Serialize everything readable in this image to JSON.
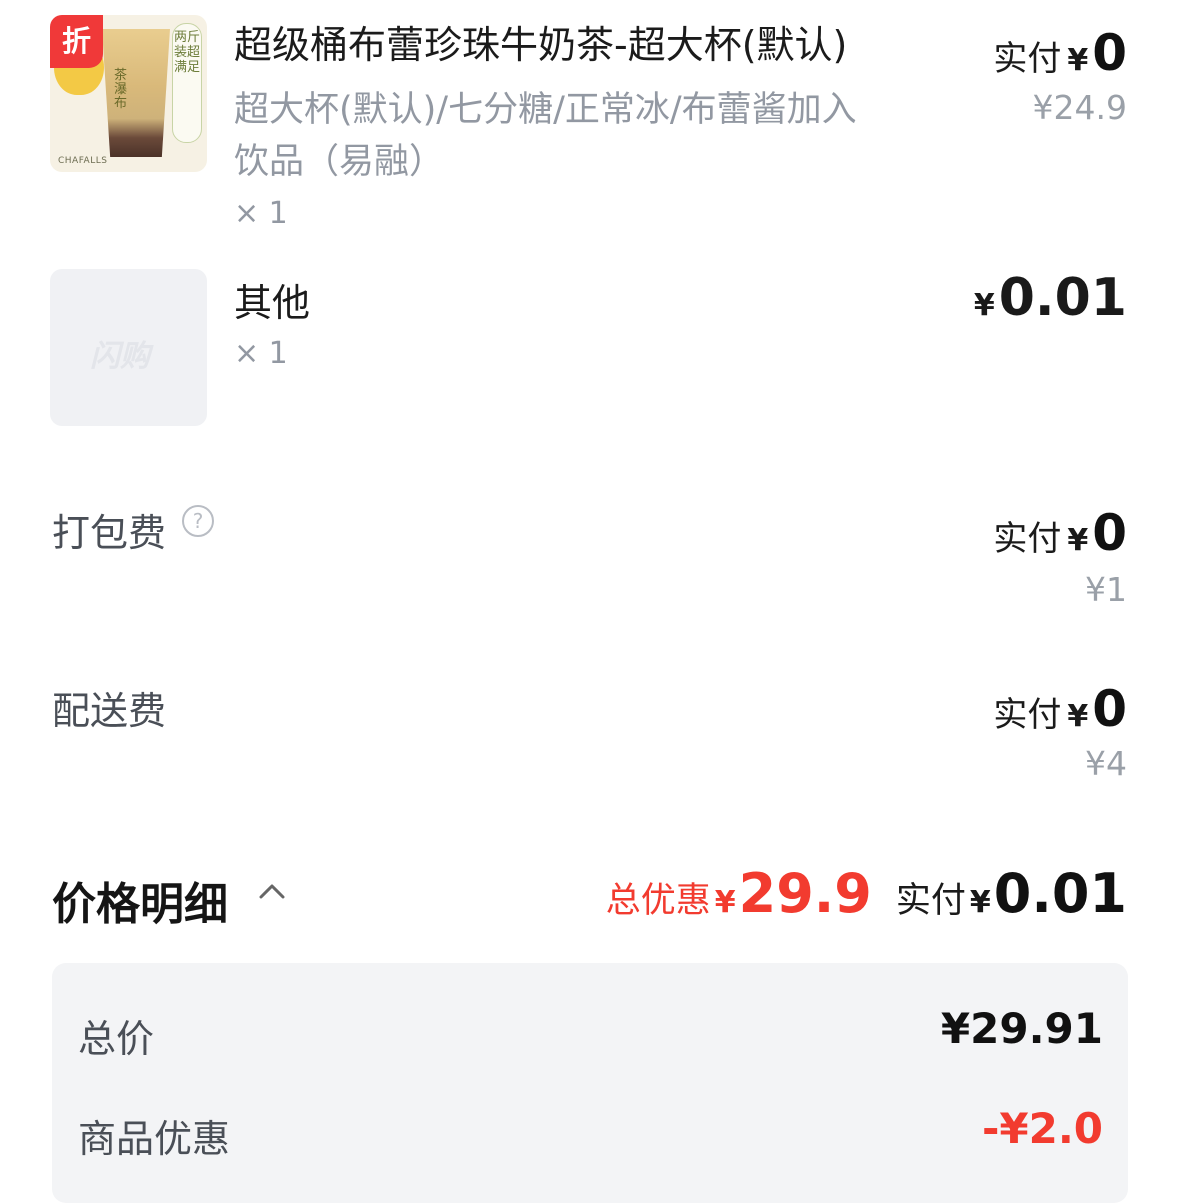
{
  "items": [
    {
      "badge": "折",
      "thumb_label": "两斤装超满足",
      "thumb_cup_text": "茶瀑布",
      "thumb_brand": "CHAFALLS",
      "name": "超级桶布蕾珍珠牛奶茶-超大杯(默认)",
      "spec": "超大杯(默认)/七分糖/正常冰/布蕾酱加入饮品（易融）",
      "qty": "× 1",
      "pay_label": "实付",
      "pay_currency": "¥",
      "pay_value": "0",
      "original_price": "¥24.9"
    },
    {
      "thumb_watermark": "闪购",
      "name": "其他",
      "qty": "× 1",
      "price_currency": "¥",
      "price_value": "0.01"
    }
  ],
  "fees": [
    {
      "label": "打包费",
      "help_icon": "question-circle-icon",
      "pay_label": "实付",
      "pay_currency": "¥",
      "pay_value": "0",
      "original_price": "¥1"
    },
    {
      "label": "配送费",
      "pay_label": "实付",
      "pay_currency": "¥",
      "pay_value": "0",
      "original_price": "¥4"
    }
  ],
  "price_detail": {
    "title": "价格明细",
    "toggle_icon": "chevron-up-icon",
    "discount_label": "总优惠",
    "discount_currency": "¥",
    "discount_value": "29.9",
    "pay_label": "实付",
    "pay_currency": "¥",
    "pay_value": "0.01",
    "rows": [
      {
        "label": "总价",
        "value": "¥29.91"
      },
      {
        "label": "商品优惠",
        "value": "-¥2.0"
      }
    ]
  },
  "colors": {
    "accent_red": "#f23b2f",
    "muted_text": "#9298a2",
    "card_bg": "#f3f4f6"
  }
}
